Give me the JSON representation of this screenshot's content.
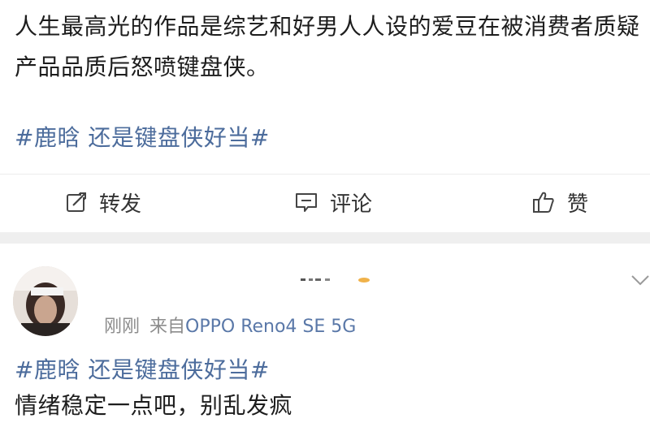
{
  "post": {
    "text": "人生最高光的作品是综艺和好男人人设的爱豆在被消费者质疑产品品质后怒喷键盘侠。",
    "hashtag": "#鹿晗 还是键盘侠好当#",
    "actions": {
      "repost_label": "转发",
      "comment_label": "评论",
      "like_label": "赞"
    }
  },
  "comment": {
    "time": "刚刚",
    "source_prefix": "来自",
    "device": "OPPO Reno4 SE 5G",
    "hashtag": "#鹿晗 还是键盘侠好当#",
    "text": "情绪稳定一点吧，别乱发疯"
  },
  "colors": {
    "link": "#4c6c9c",
    "meta": "#8c8c8c",
    "separator": "#efefef"
  }
}
